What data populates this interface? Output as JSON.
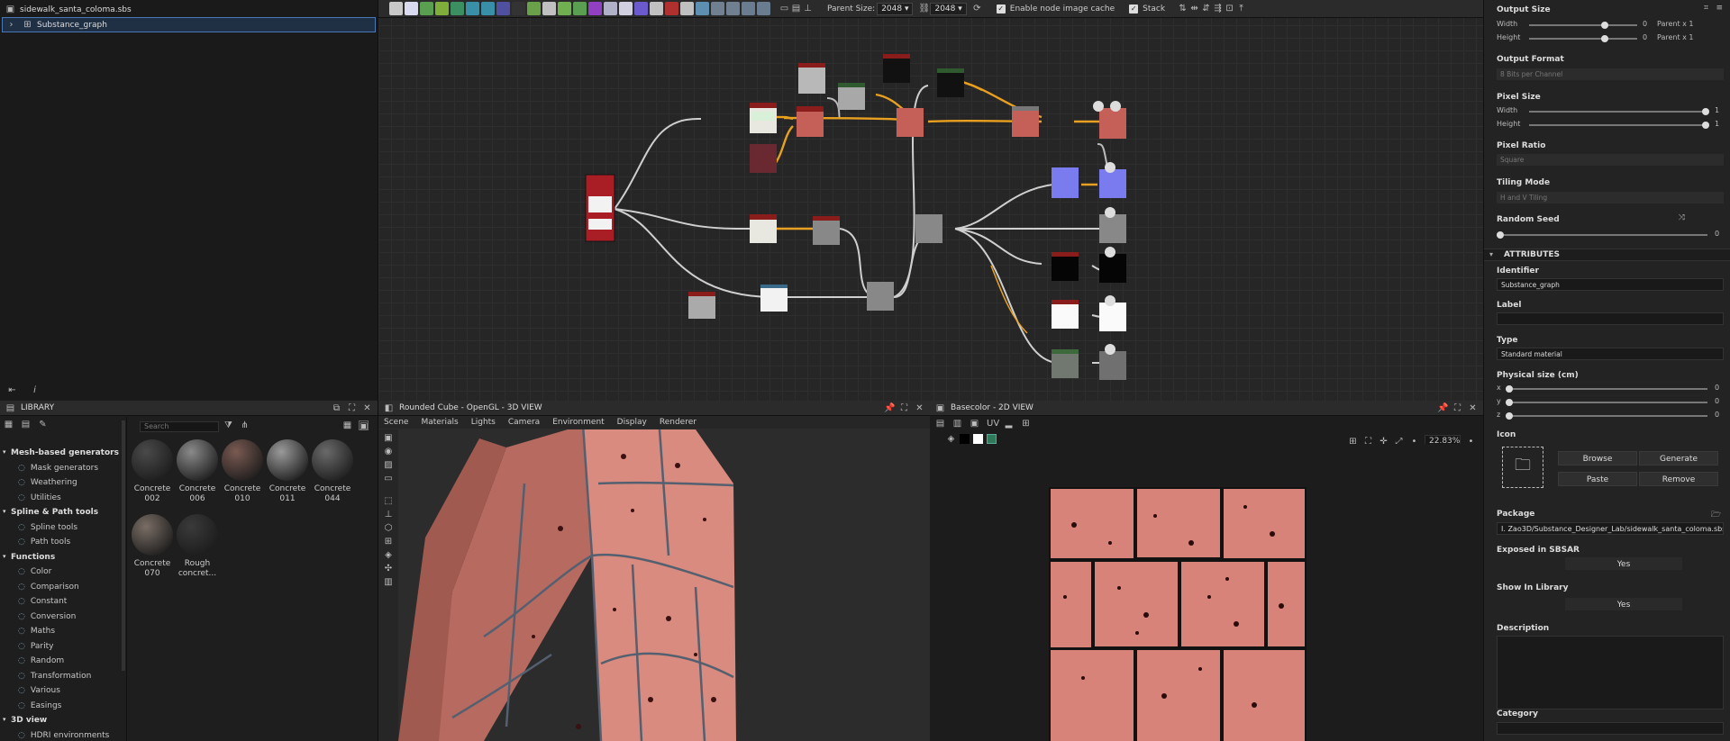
{
  "explorer": {
    "file": "sidewalk_santa_coloma.sbs",
    "graph": "Substance_graph"
  },
  "graph_toolbar": {
    "parent_size_label": "Parent Size:",
    "parent_size_value": "2048",
    "size_value": "2048",
    "cache_label": "Enable node image cache",
    "stack_label": "Stack"
  },
  "properties": {
    "output_size": "Output Size",
    "width": "Width",
    "height": "Height",
    "os_width_value": "0",
    "os_height_value": "0",
    "os_width_parent": "Parent x 1",
    "os_height_parent": "Parent x 1",
    "output_format": "Output Format",
    "output_format_value": "8 Bits per Channel",
    "pixel_size": "Pixel Size",
    "ps_width_value": "1",
    "ps_height_value": "1",
    "pixel_ratio": "Pixel Ratio",
    "pixel_ratio_value": "Square",
    "tiling_mode": "Tiling Mode",
    "tiling_mode_value": "H and V Tiling",
    "random_seed": "Random Seed",
    "random_seed_value": "0",
    "attributes": "ATTRIBUTES",
    "identifier": "Identifier",
    "identifier_value": "Substance_graph",
    "label": "Label",
    "type": "Type",
    "type_value": "Standard material",
    "physical_size": "Physical size (cm)",
    "axis_x": "x",
    "axis_y": "y",
    "axis_z": "z",
    "phys_x": "0",
    "phys_y": "0",
    "phys_z": "0",
    "icon": "Icon",
    "browse": "Browse",
    "generate": "Generate",
    "paste": "Paste",
    "remove": "Remove",
    "package": "Package",
    "package_value": "I. Zao3D/Substance_Designer_Lab/sidewalk_santa_coloma.sbs",
    "exposed": "Exposed in SBSAR",
    "exposed_value": "Yes",
    "show_library": "Show In Library",
    "show_library_value": "Yes",
    "description": "Description",
    "category": "Category"
  },
  "library": {
    "title": "LIBRARY",
    "search_placeholder": "Search",
    "categories": [
      {
        "label": "Mesh-based generators",
        "items": [
          "Mask generators",
          "Weathering",
          "Utilities"
        ]
      },
      {
        "label": "Spline & Path tools",
        "items": [
          "Spline tools",
          "Path tools"
        ]
      },
      {
        "label": "Functions",
        "items": [
          "Color",
          "Comparison",
          "Constant",
          "Conversion",
          "Maths",
          "Parity",
          "Random",
          "Transformation",
          "Various",
          "Easings"
        ]
      },
      {
        "label": "3D view",
        "items": [
          "HDRI environments"
        ]
      }
    ],
    "thumbs": [
      {
        "label1": "Concrete",
        "label2": "002"
      },
      {
        "label1": "Concrete",
        "label2": "006"
      },
      {
        "label1": "Concrete",
        "label2": "010"
      },
      {
        "label1": "Concrete",
        "label2": "011"
      },
      {
        "label1": "Concrete",
        "label2": "044"
      },
      {
        "label1": "Concrete",
        "label2": "070"
      },
      {
        "label1": "Rough",
        "label2": "concret..."
      }
    ]
  },
  "view3d": {
    "title": "Rounded Cube - OpenGL - 3D VIEW",
    "menu": [
      "Scene",
      "Materials",
      "Lights",
      "Camera",
      "Environment",
      "Display",
      "Renderer"
    ]
  },
  "view2d": {
    "title": "Basecolor - 2D VIEW",
    "zoom": "22.83%"
  },
  "colors": {
    "accent": "#4a78b5",
    "brick": "#c76a62",
    "wire_orange": "#e8a020"
  }
}
